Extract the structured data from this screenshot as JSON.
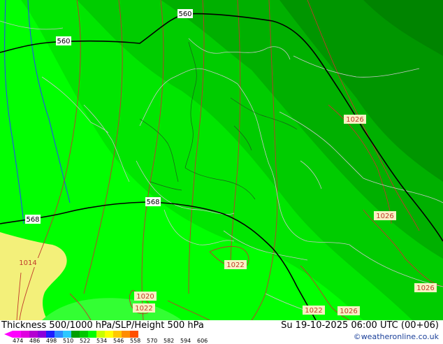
{
  "map": {
    "height_labels": [
      "560",
      "560",
      "568",
      "568"
    ],
    "pressure_labels": [
      "1026",
      "1026",
      "1026",
      "1022",
      "1022",
      "1014",
      "1020",
      "1022",
      "1026"
    ],
    "colors": {
      "band_512_524": "#00ff00",
      "band_524_536": "#00dd00",
      "band_536_548": "#00c400",
      "band_548_560": "#00a800",
      "band_560_572": "#008c00",
      "warm": "#f3f07a",
      "isobar": "#c0392b",
      "border": "#c8c8c8",
      "height": "#000000",
      "thickness_blue": "#2244ff"
    }
  },
  "footer": {
    "title": "Thickness 500/1000 hPa/SLP/Height 500 hPa",
    "datetime": "Su 19-10-2025 06:00 UTC (00+06)",
    "credit": "©weatheronline.co.uk",
    "legend_colors": [
      "#ff00ff",
      "#e000e0",
      "#b400d2",
      "#8c00dc",
      "#1e1eff",
      "#2d8cff",
      "#2dc8ff",
      "#00a000",
      "#00c800",
      "#00ff00",
      "#c8ff00",
      "#ffff00",
      "#ffc800",
      "#ff8c00",
      "#ff5000"
    ],
    "legend_ticks": [
      "474",
      "486",
      "498",
      "510",
      "522",
      "534",
      "546",
      "558",
      "570",
      "582",
      "594",
      "606"
    ]
  }
}
